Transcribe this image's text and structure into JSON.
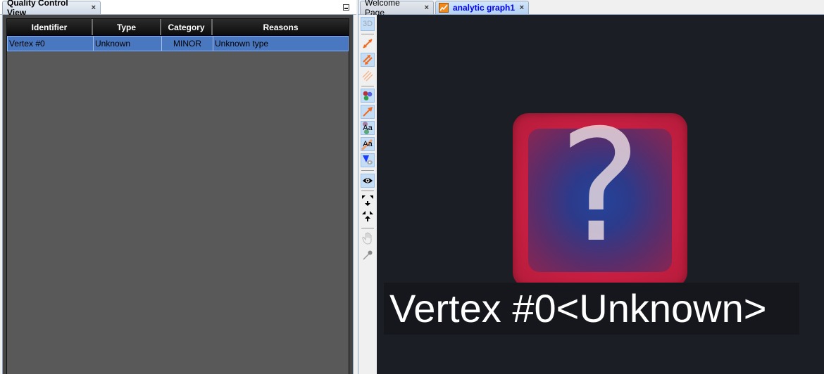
{
  "left_panel": {
    "tab_title": "Quality Control View",
    "close_glyph": "×",
    "table": {
      "columns": [
        "Identifier",
        "Type",
        "Category",
        "Reasons"
      ],
      "rows": [
        {
          "identifier": "Vertex #0",
          "type": "Unknown",
          "category": "MINOR",
          "reasons": "Unknown type"
        }
      ],
      "selected_row": 0
    }
  },
  "right_panel": {
    "tabs": [
      {
        "label": "Welcome Page",
        "active": false,
        "close_glyph": "×"
      },
      {
        "label": "analytic graph1",
        "active": true,
        "icon": "chart-line-icon",
        "close_glyph": "×"
      }
    ],
    "toolbar": {
      "items": [
        {
          "name": "3d-toggle",
          "label": "3D",
          "selected": true
        },
        {
          "name": "directed-edges",
          "icon": "arrow-single-icon",
          "selected": false
        },
        {
          "name": "bidirectional-edges",
          "icon": "arrow-double-icon",
          "selected": true
        },
        {
          "name": "transaction-edges",
          "icon": "arrow-multi-icon",
          "selected": false
        },
        {
          "name": "show-nodes",
          "icon": "nodes-icon",
          "selected": true
        },
        {
          "name": "show-connections",
          "icon": "arrow-icon",
          "selected": true
        },
        {
          "name": "node-labels",
          "icon": "node-label-icon",
          "label": "Aa",
          "selected": true
        },
        {
          "name": "connection-labels",
          "icon": "connection-label-icon",
          "label": "Aa",
          "selected": true
        },
        {
          "name": "blazes",
          "icon": "blaze-icon",
          "selected": true
        },
        {
          "name": "visibility",
          "icon": "eye-icon",
          "selected": true
        },
        {
          "name": "expand-collapse",
          "icon": "expand-collapse-icon",
          "selected": false
        },
        {
          "name": "pan-mode",
          "icon": "hand-icon",
          "selected": false
        },
        {
          "name": "pin-mode",
          "icon": "pin-icon",
          "selected": false
        }
      ]
    },
    "graph": {
      "node": {
        "icon": "question-icon",
        "glyph": "?",
        "label": "Vertex #0<Unknown>",
        "colors": {
          "border": "#c91f42",
          "background": "#23449a"
        }
      },
      "background_color": "#1b1e25"
    }
  }
}
